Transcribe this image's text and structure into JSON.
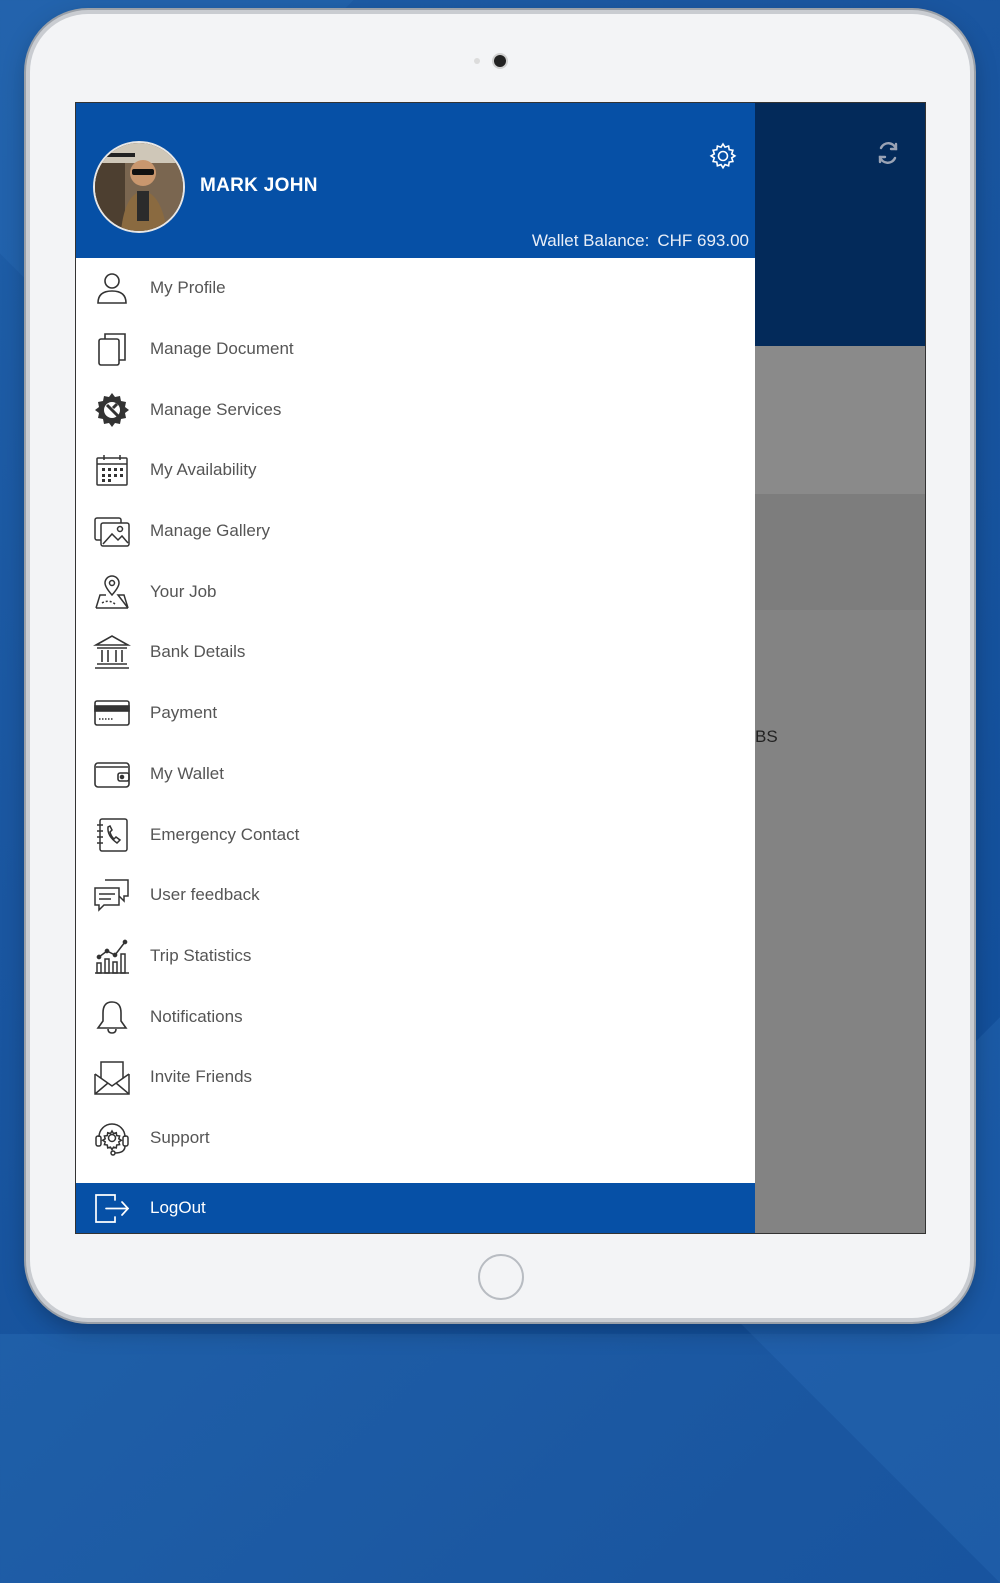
{
  "user": {
    "name": "MARK JOHN",
    "wallet_label": "Wallet Balance:",
    "wallet_amount": "CHF 693.00"
  },
  "menu": [
    {
      "label": "My Profile",
      "icon": "user-icon"
    },
    {
      "label": "Manage Document",
      "icon": "document-icon"
    },
    {
      "label": "Manage Services",
      "icon": "services-gear-icon"
    },
    {
      "label": "My Availability",
      "icon": "calendar-icon"
    },
    {
      "label": "Manage Gallery",
      "icon": "gallery-icon"
    },
    {
      "label": "Your Job",
      "icon": "map-pin-icon"
    },
    {
      "label": "Bank Details",
      "icon": "bank-icon"
    },
    {
      "label": "Payment",
      "icon": "credit-card-icon"
    },
    {
      "label": "My Wallet",
      "icon": "wallet-icon"
    },
    {
      "label": "Emergency Contact",
      "icon": "phone-book-icon"
    },
    {
      "label": "User feedback",
      "icon": "chat-icon"
    },
    {
      "label": "Trip Statistics",
      "icon": "chart-icon"
    },
    {
      "label": "Notifications",
      "icon": "bell-icon"
    },
    {
      "label": "Invite Friends",
      "icon": "envelope-icon"
    },
    {
      "label": "Support",
      "icon": "support-headset-icon"
    }
  ],
  "logout": {
    "label": "LogOut",
    "icon": "logout-icon"
  },
  "background_screen": {
    "partial_text": "BS"
  },
  "colors": {
    "primary": "#0650a6",
    "dark_header": "#032a5a",
    "overlay": "#838383",
    "text": "#555555"
  }
}
